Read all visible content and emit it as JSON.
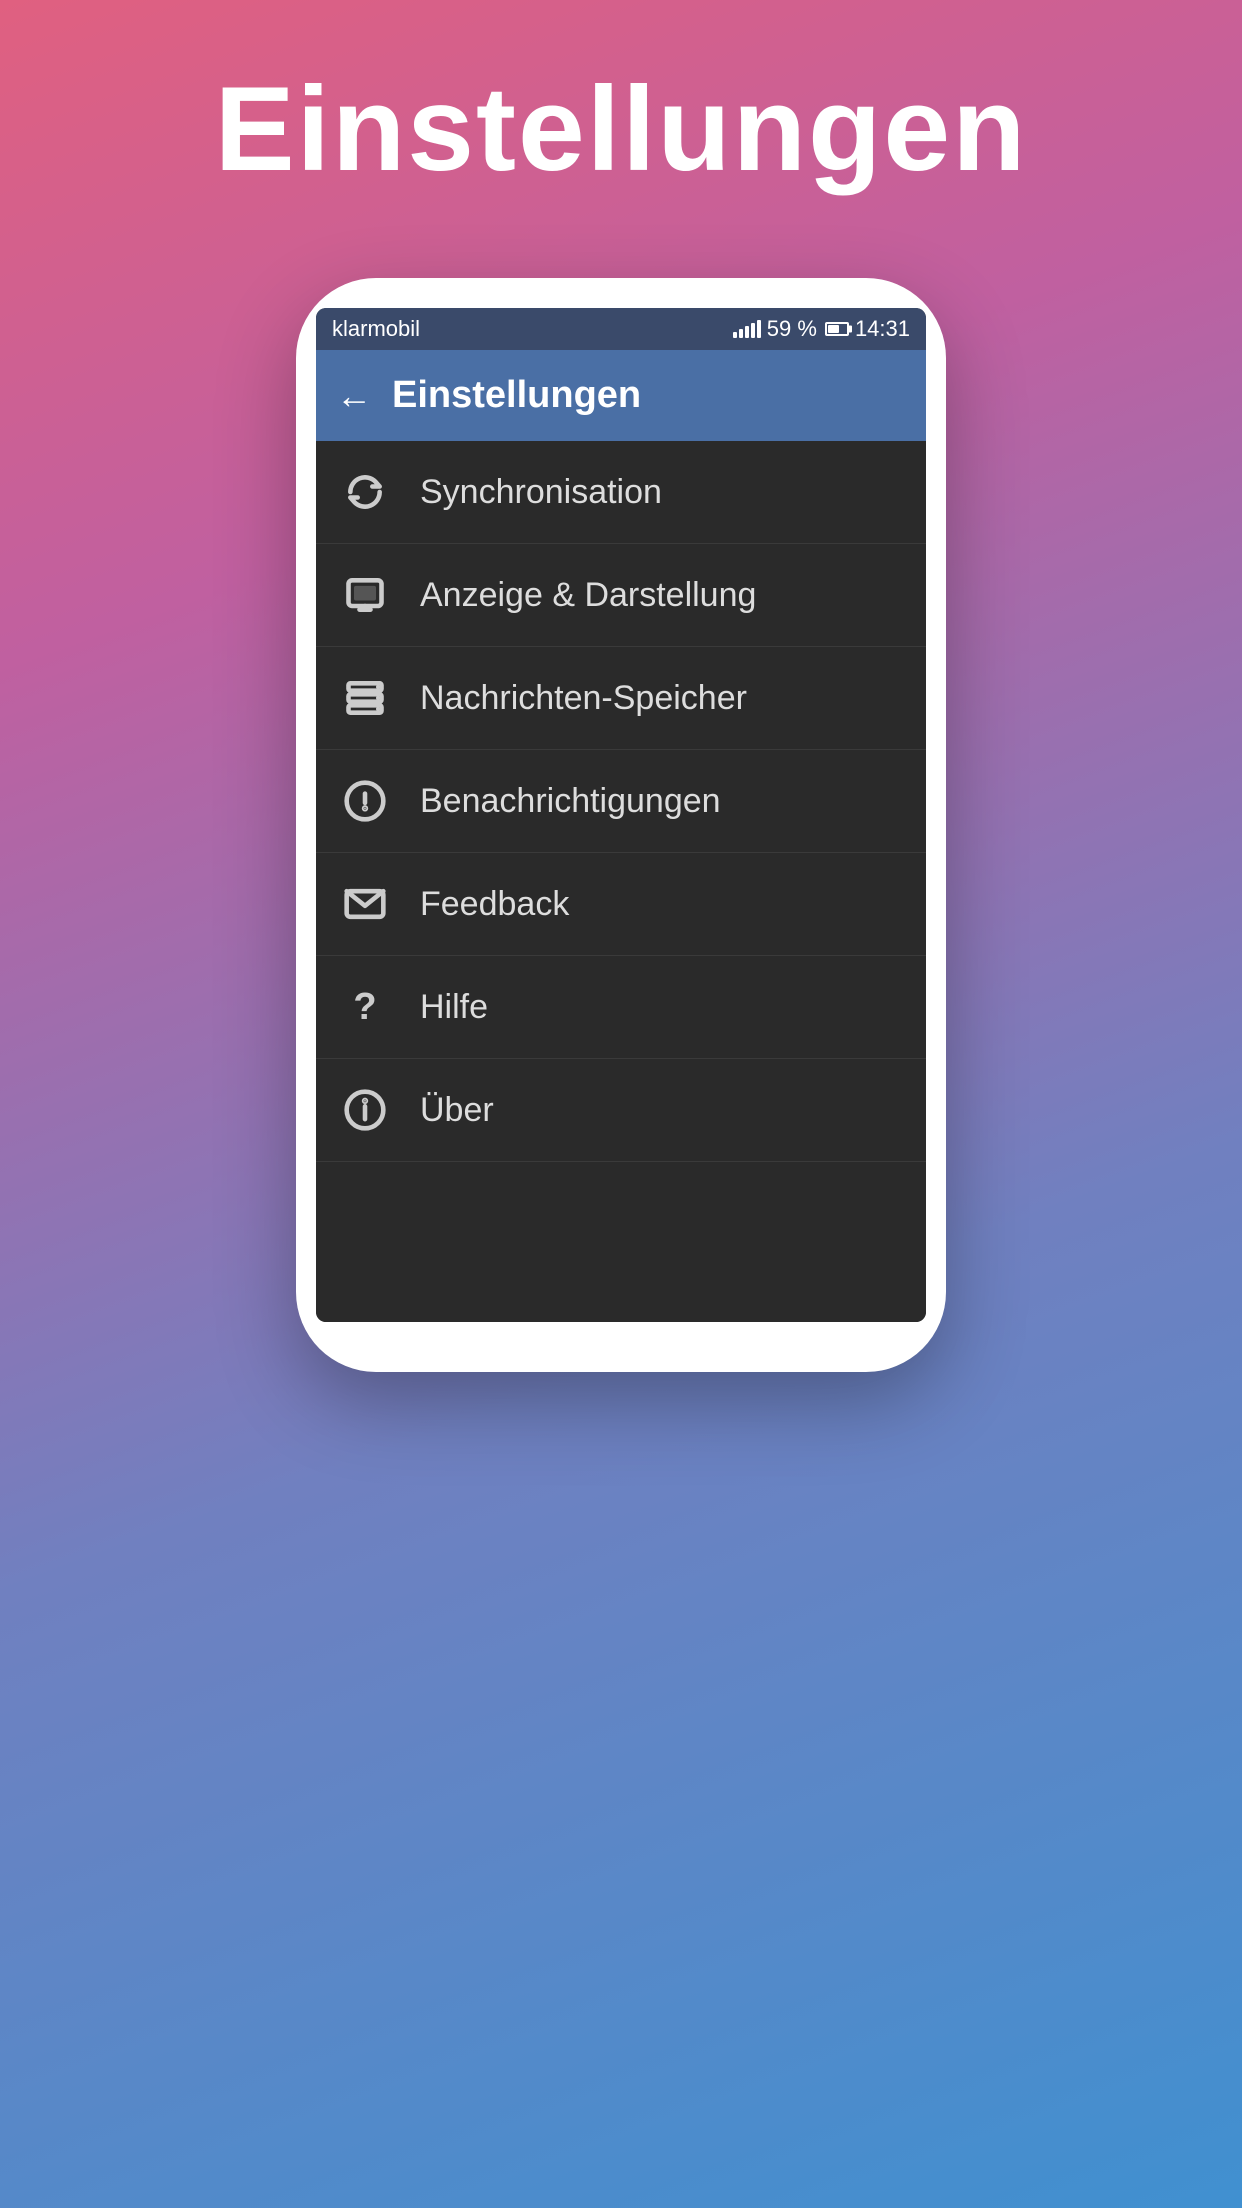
{
  "page": {
    "title": "Einstellungen",
    "background_gradient_start": "#e06080",
    "background_gradient_end": "#4090d0"
  },
  "status_bar": {
    "carrier": "klarmobil",
    "signal": "59 %",
    "time": "14:31"
  },
  "header": {
    "back_label": "←",
    "title": "Einstellungen"
  },
  "menu_items": [
    {
      "id": "synchronisation",
      "icon": "sync",
      "label": "Synchronisation"
    },
    {
      "id": "anzeige",
      "icon": "display",
      "label": "Anzeige & Darstellung"
    },
    {
      "id": "nachrichten",
      "icon": "storage",
      "label": "Nachrichten-Speicher"
    },
    {
      "id": "benachrichtigungen",
      "icon": "alert",
      "label": "Benachrichtigungen"
    },
    {
      "id": "feedback",
      "icon": "mail",
      "label": "Feedback"
    },
    {
      "id": "hilfe",
      "icon": "help",
      "label": "Hilfe"
    },
    {
      "id": "ueber",
      "icon": "info",
      "label": "Über"
    }
  ]
}
